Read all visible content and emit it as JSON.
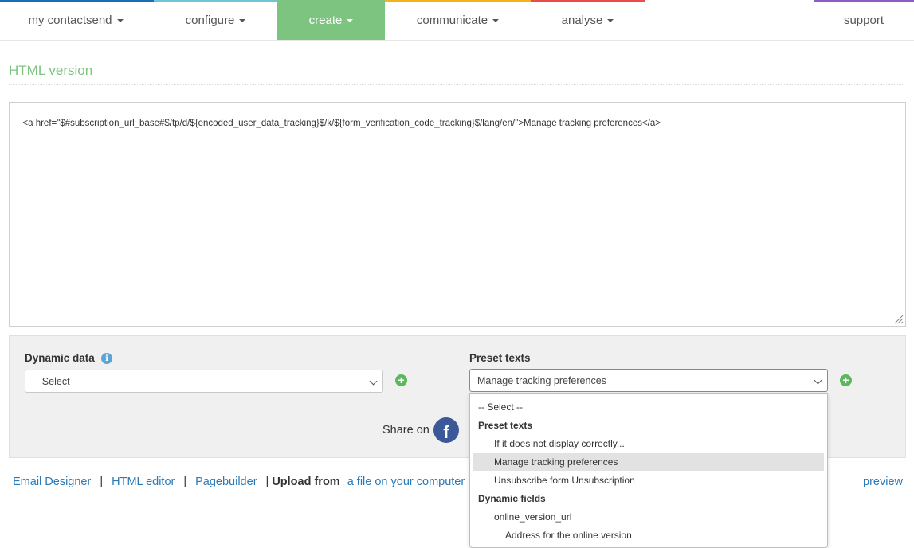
{
  "nav": {
    "items": [
      {
        "label": "my contactsend",
        "has_caret": true
      },
      {
        "label": "configure",
        "has_caret": true
      },
      {
        "label": "create",
        "has_caret": true,
        "active": true
      },
      {
        "label": "communicate",
        "has_caret": true
      },
      {
        "label": "analyse",
        "has_caret": true
      },
      {
        "label": "support",
        "has_caret": false
      }
    ],
    "stripe_colors": [
      "#1d6fb5",
      "#6ec5d3",
      "#7cc47f",
      "#f5b21b",
      "#ec4b4b",
      "#8e5cc6"
    ],
    "active_color": "#7cc47f"
  },
  "page": {
    "section_title": "HTML version",
    "html_code": "<a href=\"$#subscription_url_base#$/tp/d/${encoded_user_data_tracking}$/k/${form_verification_code_tracking}$/lang/en/\">Manage tracking preferences</a>"
  },
  "dynamic_data": {
    "label": "Dynamic data",
    "info_icon": "info-icon",
    "selected": "-- Select --"
  },
  "preset_texts": {
    "label": "Preset texts",
    "selected": "Manage tracking preferences",
    "options": [
      {
        "kind": "top",
        "label": "-- Select --"
      },
      {
        "kind": "group",
        "label": "Preset texts"
      },
      {
        "kind": "opt",
        "label": "If it does not display correctly..."
      },
      {
        "kind": "opt",
        "label": "Manage tracking preferences",
        "highlighted": true
      },
      {
        "kind": "opt",
        "label": "Unsubscribe form Unsubscription"
      },
      {
        "kind": "group",
        "label": "Dynamic fields"
      },
      {
        "kind": "opt",
        "label": "online_version_url"
      },
      {
        "kind": "opt2",
        "label": "Address for the online version"
      }
    ]
  },
  "share": {
    "label": "Share on",
    "icon": "facebook-icon"
  },
  "links": {
    "email_designer": "Email Designer",
    "html_editor": "HTML editor",
    "pagebuilder": "Pagebuilder",
    "upload_from": "Upload from",
    "upload_file": "a file on your computer",
    "preview": "preview",
    "separator": "|"
  },
  "colors": {
    "link": "#2a7ab8",
    "green_plus": "#5cb85c",
    "facebook": "#3b5998"
  }
}
